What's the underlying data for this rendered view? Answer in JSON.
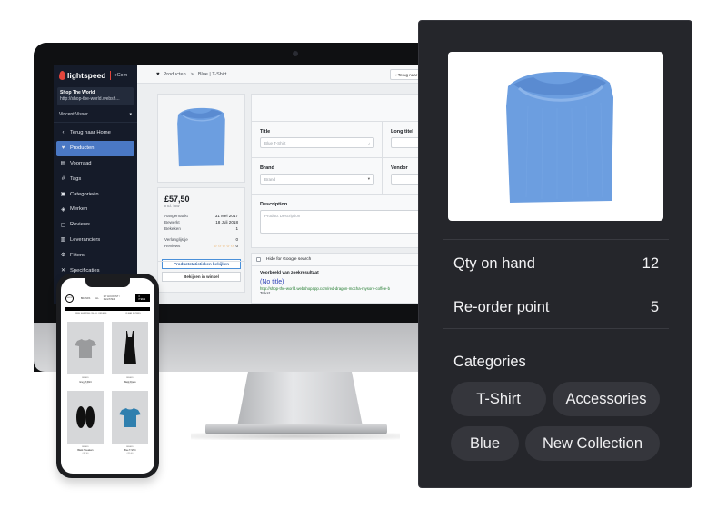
{
  "admin": {
    "brand": {
      "name": "lightspeed",
      "product": "eCom"
    },
    "shop": {
      "name": "Shop The World",
      "url": "http://shop-the-world.websh..."
    },
    "user": {
      "name": "Vincent Visser"
    },
    "nav": [
      {
        "label": "Terug naar Home",
        "icon": "chevron-left-icon",
        "glyph": "‹",
        "active": false
      },
      {
        "label": "Producten",
        "icon": "shirt-icon",
        "glyph": "♥",
        "active": true
      },
      {
        "label": "Voorraad",
        "icon": "inventory-icon",
        "glyph": "▤",
        "active": false
      },
      {
        "label": "Tags",
        "icon": "tag-hash-icon",
        "glyph": "#",
        "active": false
      },
      {
        "label": "Categorieën",
        "icon": "folder-icon",
        "glyph": "▣",
        "active": false
      },
      {
        "label": "Merken",
        "icon": "brand-tag-icon",
        "glyph": "◈",
        "active": false
      },
      {
        "label": "Reviews",
        "icon": "review-icon",
        "glyph": "▢",
        "active": false
      },
      {
        "label": "Leveranciers",
        "icon": "supplier-icon",
        "glyph": "▥",
        "active": false
      },
      {
        "label": "Filters",
        "icon": "filter-icon",
        "glyph": "⚙",
        "active": false
      },
      {
        "label": "Specificaties",
        "icon": "tools-icon",
        "glyph": "✕",
        "active": false
      }
    ],
    "breadcrumb": {
      "section": "Producten",
      "separator": ">",
      "current": "Blue | T-Shirt"
    },
    "back_button": "‹  Terug naar Producten",
    "product": {
      "price": "£57,50",
      "price_note": "Incl. btw",
      "meta": [
        {
          "label": "Aangemaakt",
          "value": "31 Mei 2017"
        },
        {
          "label": "Bewerkt",
          "value": "18 Juli 2018"
        },
        {
          "label": "Bekeken",
          "value": "1"
        }
      ],
      "meta2": [
        {
          "label": "Verlanglijstje",
          "value": "0"
        },
        {
          "label": "Reviews",
          "value": "0",
          "stars": "☆☆☆☆☆"
        }
      ],
      "stats_button": "Productstatistieken bekijken",
      "view_button": "Bekijken in winkel"
    },
    "form": {
      "title_label": "Title",
      "title_value": "Blue T-Shirt",
      "long_title_label": "Long titel",
      "brand_label": "Brand",
      "brand_placeholder": "Brand",
      "vendor_label": "Vendor",
      "description_label": "Description",
      "description_placeholder": "Product Description"
    },
    "seo": {
      "hide_label": "Hide for Google search",
      "hide_checked": false,
      "preview_heading": "Voorbeeld van zoekresultaat",
      "preview_title": "(No title)",
      "preview_url": "http://shop-the-world.webshopapp.com/red-dragon-mocha-mysore-coffee-b",
      "preview_text": "Tekst"
    }
  },
  "phone": {
    "logo": "SHOP",
    "nav": [
      "BRANDS",
      "ALL",
      "MY ACCOUNT / REGISTER"
    ],
    "cart": "0 ITEMS",
    "subnav": [
      "FREE SHIPPING ON ALL ORDERS",
      "CLEAR FILTERS"
    ],
    "products": [
      {
        "brand": "BRAND",
        "name": "Grey T-Shirt",
        "price": "£25,00",
        "kind": "tshirt",
        "color": "#9a9b9d"
      },
      {
        "brand": "BRAND",
        "name": "Black Dress",
        "price": "£29,00",
        "kind": "dress",
        "color": "#111111"
      },
      {
        "brand": "BRAND",
        "name": "Black Sneakers",
        "price": "£37,00",
        "kind": "shoes",
        "color": "#111111"
      },
      {
        "brand": "BRAND",
        "name": "Blue T-Shirt",
        "price": "£25,00",
        "kind": "tshirt",
        "color": "#2f7fae"
      }
    ]
  },
  "panel": {
    "qty_label": "Qty on hand",
    "qty_value": "12",
    "reorder_label": "Re-order point",
    "reorder_value": "5",
    "categories_heading": "Categories",
    "categories": [
      "T-Shirt",
      "Accessories",
      "Blue",
      "New Collection"
    ]
  },
  "colors": {
    "accent": "#4a78c4",
    "sidebar_bg": "#151b29",
    "panel_bg": "#25262b",
    "chip_bg": "#35363c",
    "product_blue": "#6c9ee0",
    "star_orange": "#e8922a"
  }
}
